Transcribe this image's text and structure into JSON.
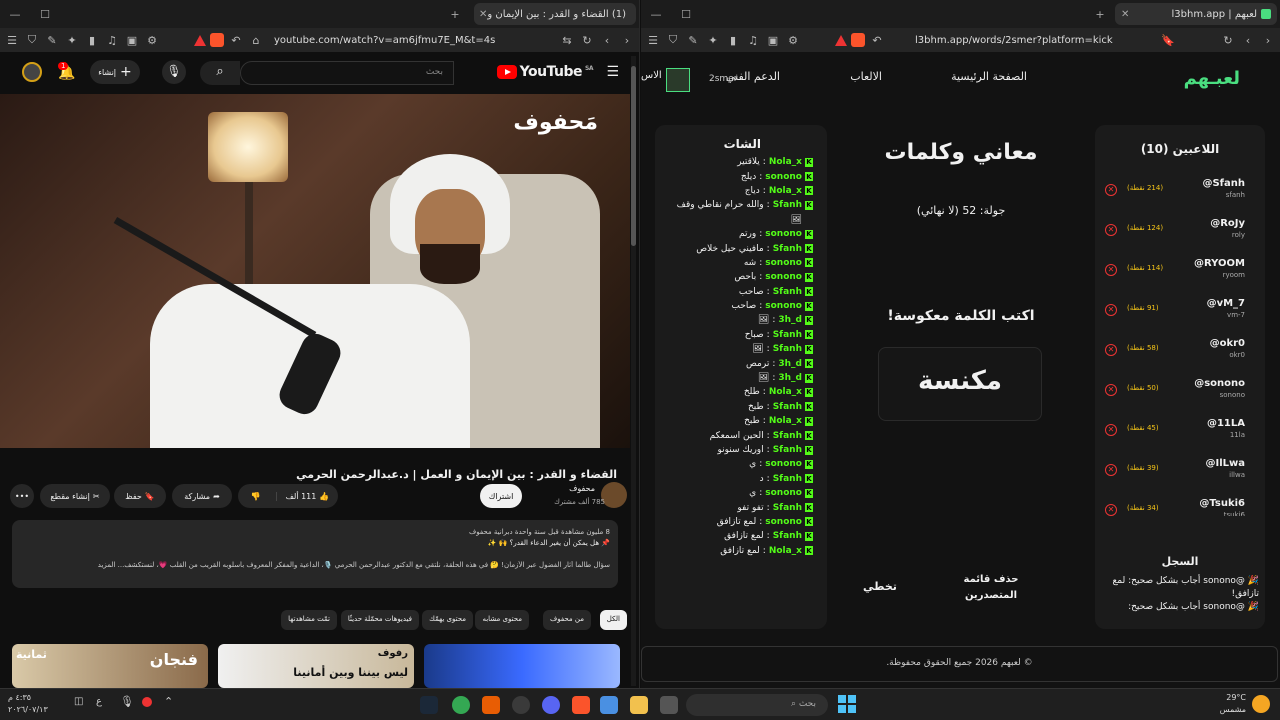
{
  "left_window": {
    "tab_title": "(1) القضاء و القدر : بين الإيمان و",
    "url": "youtube.com/watch?v=am6jfmu7E_M&t=4s",
    "youtube": {
      "logo_text": "YouTube",
      "region": "SA",
      "search_placeholder": "بحث",
      "create_label": "إنشاء",
      "notif_count": "1",
      "notif_badge": "99+",
      "video_watermark": "مَحفوف",
      "video_title": "القضاء و القدر : بين الإيمان و العمل | د.عبدالرحمن الحرمي",
      "channel_name": "محفوف",
      "subscribers": "785 ألف مشترك",
      "subscribe_label": "اشتراك",
      "likes": "111 ألف",
      "share_label": "مشاركة",
      "save_label": "حفظ",
      "clip_label": "إنشاء مقطع",
      "more_label": "•••",
      "desc_line1": "8 مليون مشاهدة قبل سنة واحدة دبرانية محفوف",
      "desc_line2": "📌 هل يمكن أن يغير الدعاء القدر؟ 🙌 ✨",
      "desc_line3": "سؤال طالما أثار الفضول عبر الأزمان! 🤔 في هذه الحلقة، نلتقي مع الدكتور عبدالرحمن الحرمي 🎙️، الداعية والمفكر المعروف بأسلوبه القريب من القلب 💗، لنستكشف... المزيد",
      "chips": [
        "الكل",
        "من محفوف",
        "محتوى مشابه",
        "محتوى يهمّك",
        "فيديوهات محمّلة حديثًا",
        "تمّت مشاهدتها"
      ],
      "thumb_texts": [
        "ثمانية",
        "رفوف",
        "ليس بيننا وبين أمانينا",
        "فنجان"
      ]
    }
  },
  "right_window": {
    "tab_title": "لعبهم | l3bhm.app",
    "url": "l3bhm.app/words/2smer?platform=kick",
    "app": {
      "logo": "لعبـهم",
      "nav": [
        "الصفحة الرئيسية",
        "الالعاب",
        "الدعم الفني",
        "الاس"
      ],
      "username": "2smer",
      "players_title": "اللاعبين (10)",
      "players": [
        {
          "name": "@Sfanh",
          "handle": "sfanh",
          "points": "(214 نقطة)"
        },
        {
          "name": "@RoJy",
          "handle": "roly",
          "points": "(124 نقطة)"
        },
        {
          "name": "@RYOOM",
          "handle": "ryoom",
          "points": "(114 نقطة)"
        },
        {
          "name": "@vM_7",
          "handle": "vm-7",
          "points": "(91 نقطة)"
        },
        {
          "name": "@okr0",
          "handle": "okr0",
          "points": "(58 نقطة)"
        },
        {
          "name": "@sonono",
          "handle": "sonono",
          "points": "(50 نقطة)"
        },
        {
          "name": "@11LA",
          "handle": "11la",
          "points": "(45 نقطة)"
        },
        {
          "name": "@IlLwa",
          "handle": "illwa",
          "points": "(39 نقطة)"
        },
        {
          "name": "@Tsuki6",
          "handle": "tsuki6",
          "points": "(34 نقطة)"
        }
      ],
      "log_title": "السجل",
      "log": [
        "🎉 @sonono أجاب بشكل صحيح: لمع تازافق!",
        "🎉 @sonono أجاب بشكل صحيح:"
      ],
      "game_title": "معاني وكلمات",
      "round": "جولة: 52 (لا نهائي)",
      "prompt": "اكتب الكلمة معكوسة!",
      "word": "مكنسة",
      "skip_label": "تخطي",
      "clear_leaders_label": "حذف قائمة المتصدرين",
      "chat_title": "الشات",
      "chat": [
        {
          "u": "Nola_x",
          "m": "يلاقتير"
        },
        {
          "u": "sonono",
          "m": "ديلج"
        },
        {
          "u": "Nola_x",
          "m": "دياج"
        },
        {
          "u": "Sfanh",
          "m": "والله حرام نقاطي وقف"
        },
        {
          "u": "",
          "m": "🖼"
        },
        {
          "u": "sonono",
          "m": "ورتم"
        },
        {
          "u": "Sfanh",
          "m": "مافيني حيل خلاص"
        },
        {
          "u": "sonono",
          "m": "شه"
        },
        {
          "u": "sonono",
          "m": "باحص"
        },
        {
          "u": "Sfanh",
          "m": "صاحب"
        },
        {
          "u": "sonono",
          "m": "صاحب"
        },
        {
          "u": "3h_d",
          "m": "🖼"
        },
        {
          "u": "Sfanh",
          "m": "صباح"
        },
        {
          "u": "Sfanh",
          "m": "🖼"
        },
        {
          "u": "3h_d",
          "m": "ترمص"
        },
        {
          "u": "3h_d",
          "m": "🖼"
        },
        {
          "u": "Nola_x",
          "m": "طلخ"
        },
        {
          "u": "Sfanh",
          "m": "طبخ"
        },
        {
          "u": "Nola_x",
          "m": "طبخ"
        },
        {
          "u": "Sfanh",
          "m": "الحين اسمعكم"
        },
        {
          "u": "Sfanh",
          "m": "اوريك سنونو"
        },
        {
          "u": "sonono",
          "m": "ي"
        },
        {
          "u": "Sfanh",
          "m": "د"
        },
        {
          "u": "sonono",
          "m": "ي"
        },
        {
          "u": "Sfanh",
          "m": "تفو تفو"
        },
        {
          "u": "sonono",
          "m": "لمع تازافق"
        },
        {
          "u": "Sfanh",
          "m": "لمع تازافق"
        },
        {
          "u": "Nola_x",
          "m": "لمع تازافق"
        }
      ],
      "footer": "© لعبهم 2026 جميع الحقوق محفوظة."
    }
  },
  "taskbar": {
    "time": "٤:٣٥ م",
    "date": "٢٠٢٦/٠٧/١٣",
    "lang": "ع",
    "search_placeholder": "بحث",
    "weather_temp": "29°C",
    "weather_desc": "مشمس"
  },
  "colors": {
    "kick_green": "#53fc18",
    "yt_red": "#ff0000",
    "points": "#f5c518",
    "remove": "#e33333"
  }
}
